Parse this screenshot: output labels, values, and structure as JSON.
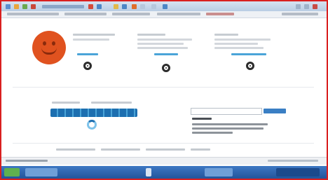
{
  "colors": {
    "frame": "#d92020",
    "accent_text": "#4aa4d8",
    "brand_blue": "#1d6fb0",
    "smiley_face": "#e0521f",
    "taskbar": "#2f64ad"
  },
  "icons": {
    "window_controls": [
      "minimize-icon",
      "maximize-icon",
      "close-icon"
    ],
    "panel_icons": [
      "gear-icon",
      "gear-icon",
      "gear-icon"
    ],
    "smiley": "smiley-face-icon",
    "search_button": "search-button"
  }
}
